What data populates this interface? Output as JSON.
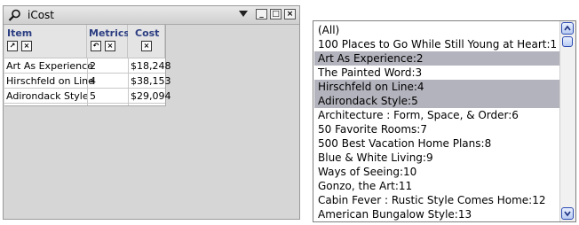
{
  "window": {
    "title": "iCost",
    "minimize_glyph": "_",
    "maximize_glyph": "□",
    "close_glyph": "×"
  },
  "table": {
    "headers": [
      "Item",
      "Metrics",
      "Cost"
    ],
    "header_button_glyphs": {
      "item": [
        "↗",
        "×"
      ],
      "metrics": [
        "↶",
        "×"
      ],
      "cost": [
        "×"
      ]
    },
    "rows": [
      {
        "item": "Art As Experience",
        "metrics": "2",
        "cost": "$18,248"
      },
      {
        "item": "Hirschfeld on Line",
        "metrics": "4",
        "cost": "$38,153"
      },
      {
        "item": "Adirondack Style",
        "metrics": "5",
        "cost": "$29,094"
      }
    ]
  },
  "list": {
    "items": [
      {
        "label": "(All)",
        "selected": false
      },
      {
        "label": "100 Places to Go While Still Young at Heart:1",
        "selected": false
      },
      {
        "label": "Art As Experience:2",
        "selected": true
      },
      {
        "label": "The Painted Word:3",
        "selected": false
      },
      {
        "label": "Hirschfeld on Line:4",
        "selected": true
      },
      {
        "label": "Adirondack Style:5",
        "selected": true
      },
      {
        "label": "Architecture : Form, Space, & Order:6",
        "selected": false
      },
      {
        "label": "50 Favorite Rooms:7",
        "selected": false
      },
      {
        "label": "500 Best Vacation Home Plans:8",
        "selected": false
      },
      {
        "label": "Blue & White Living:9",
        "selected": false
      },
      {
        "label": "Ways of Seeing:10",
        "selected": false
      },
      {
        "label": "Gonzo, the Art:11",
        "selected": false
      },
      {
        "label": "Cabin Fever : Rustic Style Comes Home:12",
        "selected": false
      },
      {
        "label": "American Bungalow Style:13",
        "selected": false
      }
    ],
    "selection_color": "#b3b3bd"
  },
  "colors": {
    "header_text": "#2c3e82",
    "frame_bg": "#d6d6d6",
    "scroll_accent": "#2e4bb0"
  }
}
